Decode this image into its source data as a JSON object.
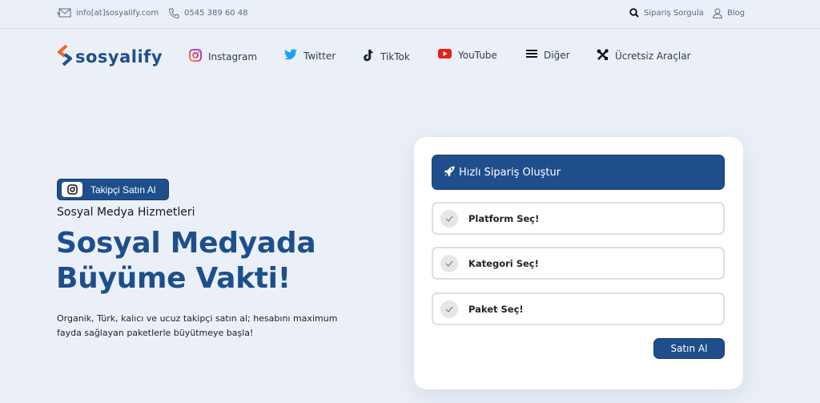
{
  "topbar": {
    "email": "info[at]sosyalify.com",
    "phone": "0545 389 60 48",
    "order_query": "Sipariş Sorgula",
    "blog": "Blog"
  },
  "nav": {
    "logo_text": "sosyalify",
    "items": [
      {
        "label": "Instagram",
        "icon": "instagram-icon"
      },
      {
        "label": "Twitter",
        "icon": "twitter-icon"
      },
      {
        "label": "TikTok",
        "icon": "tiktok-icon"
      },
      {
        "label": "YouTube",
        "icon": "youtube-icon"
      },
      {
        "label": "Diğer",
        "icon": "menu-icon"
      },
      {
        "label": "Ücretsiz Araçlar",
        "icon": "tools-icon"
      }
    ]
  },
  "hero": {
    "badge_label": "Takipçi Satın Al",
    "subtitle": "Sosyal Medya Hizmetleri",
    "headline_line1": "Sosyal Medyada",
    "headline_line2": "Büyüme Vakti!",
    "description": "Organik, Türk, kalıcı ve ucuz takipçi satın al; hesabını maximum fayda sağlayan paketlerle büyütmeye başla!"
  },
  "order_card": {
    "title": "Hızlı Sipariş Oluştur",
    "steps": [
      {
        "label": "Platform Seç!"
      },
      {
        "label": "Kategori Seç!"
      },
      {
        "label": "Paket Seç!"
      }
    ],
    "buy_label": "Satın Al"
  },
  "colors": {
    "brand": "#1e4f8c",
    "accent": "#f26522",
    "background": "#ebf0f8"
  }
}
